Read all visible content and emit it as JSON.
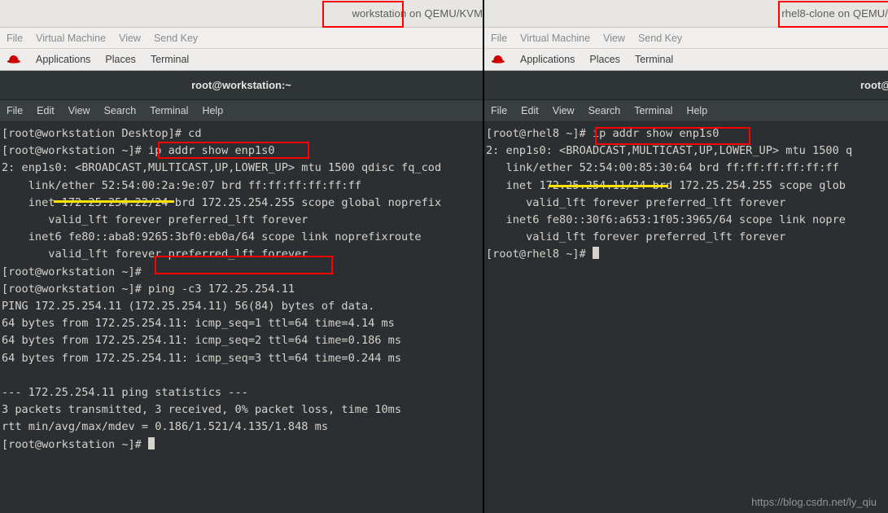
{
  "left_vm": {
    "titlebar": {
      "title": "workstation on QEMU/KVM",
      "highlight_word": "workstation"
    },
    "menu": [
      "File",
      "Virtual Machine",
      "View",
      "Send Key"
    ],
    "gnome": {
      "logo_icon": "redhat-fedora-icon",
      "items": [
        "Applications",
        "Places",
        "Terminal"
      ]
    },
    "terminal": {
      "title": "root@workstation:~",
      "menu": [
        "File",
        "Edit",
        "View",
        "Search",
        "Terminal",
        "Help"
      ],
      "lines": [
        "[root@workstation Desktop]# cd",
        "[root@workstation ~]# ip addr show enp1s0",
        "2: enp1s0: <BROADCAST,MULTICAST,UP,LOWER_UP> mtu 1500 qdisc fq_cod",
        "    link/ether 52:54:00:2a:9e:07 brd ff:ff:ff:ff:ff:ff",
        "    inet 172.25.254.22/24 brd 172.25.254.255 scope global noprefix",
        "       valid_lft forever preferred_lft forever",
        "    inet6 fe80::aba8:9265:3bf0:eb0a/64 scope link noprefixroute",
        "       valid_lft forever preferred_lft forever",
        "[root@workstation ~]#",
        "[root@workstation ~]# ping -c3 172.25.254.11",
        "PING 172.25.254.11 (172.25.254.11) 56(84) bytes of data.",
        "64 bytes from 172.25.254.11: icmp_seq=1 ttl=64 time=4.14 ms",
        "64 bytes from 172.25.254.11: icmp_seq=2 ttl=64 time=0.186 ms",
        "64 bytes from 172.25.254.11: icmp_seq=3 ttl=64 time=0.244 ms",
        "",
        "--- 172.25.254.11 ping statistics ---",
        "3 packets transmitted, 3 received, 0% packet loss, time 10ms",
        "rtt min/avg/max/mdev = 0.186/1.521/4.135/1.848 ms",
        "[root@workstation ~]# "
      ]
    }
  },
  "right_vm": {
    "titlebar": {
      "title": "rhel8-clone on QEMU/",
      "highlight_word": "rhel8-clone on QEMU/"
    },
    "menu": [
      "File",
      "Virtual Machine",
      "View",
      "Send Key"
    ],
    "gnome": {
      "logo_icon": "redhat-fedora-icon",
      "items": [
        "Applications",
        "Places",
        "Terminal"
      ]
    },
    "terminal": {
      "title": "root@",
      "menu": [
        "File",
        "Edit",
        "View",
        "Search",
        "Terminal",
        "Help"
      ],
      "lines": [
        "[root@rhel8 ~]# ip addr show enp1s0",
        "2: enp1s0: <BROADCAST,MULTICAST,UP,LOWER_UP> mtu 1500 q",
        "   link/ether 52:54:00:85:30:64 brd ff:ff:ff:ff:ff:ff",
        "   inet 172.25.254.11/24 brd 172.25.254.255 scope glob",
        "      valid_lft forever preferred_lft forever",
        "   inet6 fe80::30f6:a653:1f05:3965/64 scope link nopre",
        "      valid_lft forever preferred_lft forever",
        "[root@rhel8 ~]# "
      ]
    }
  },
  "annotations": {
    "box_color": "#fe0000",
    "underline_color": "#ffe400",
    "boxes": [
      {
        "name": "highlight-left-vm-title",
        "label": "workstation"
      },
      {
        "name": "highlight-right-vm-title",
        "label": "rhel8-clone on QEMU/"
      },
      {
        "name": "highlight-left-ip-addr-command",
        "label": "ip addr show enp1s0"
      },
      {
        "name": "highlight-left-ping-command",
        "label": "ping -c3 172.25.254.11"
      },
      {
        "name": "highlight-right-ip-addr-command",
        "label": "ip addr show enp1s0"
      }
    ],
    "underlines": [
      {
        "name": "underline-left-inet-address",
        "label": "172.25.254.22/24"
      },
      {
        "name": "underline-right-inet-address",
        "label": "172.25.254.11/24"
      }
    ]
  },
  "watermark": {
    "text": "https://blog.csdn.net/ly_qiu"
  }
}
